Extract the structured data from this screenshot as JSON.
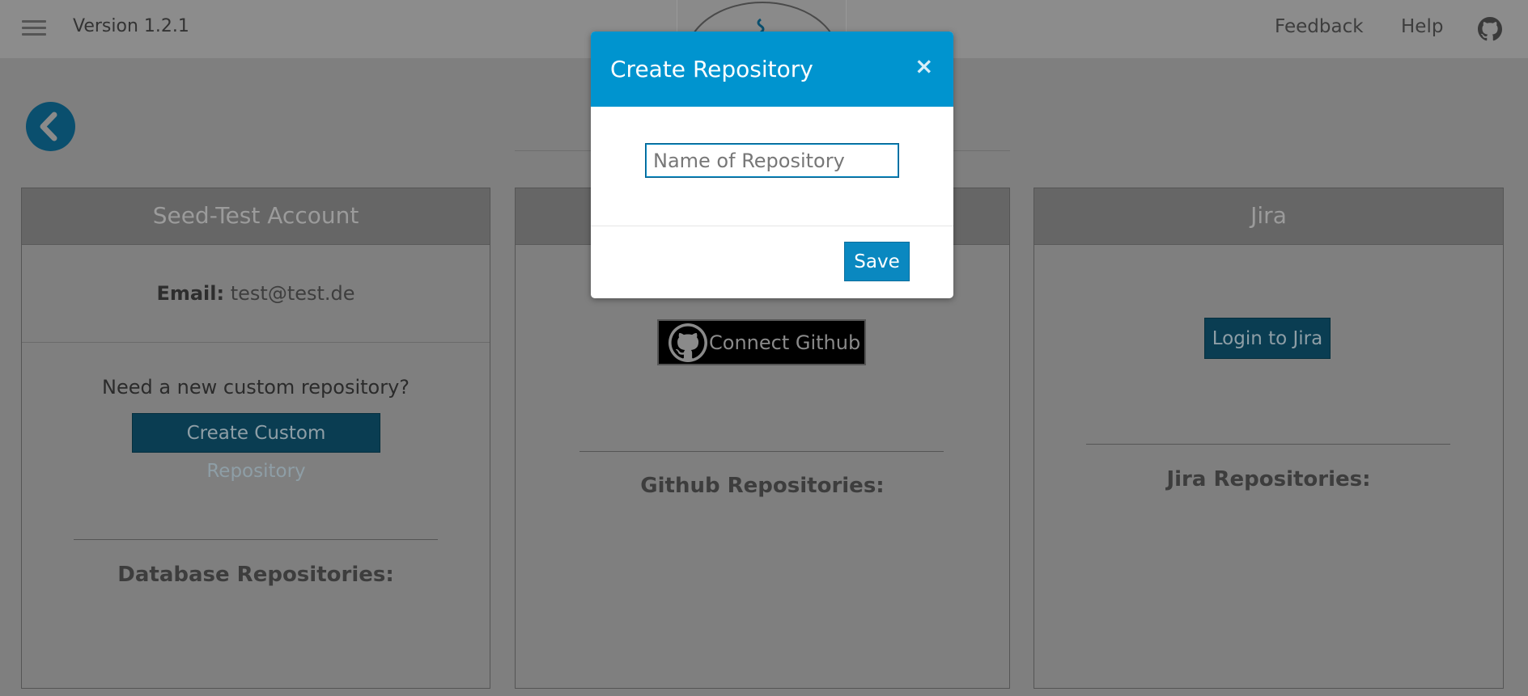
{
  "topbar": {
    "version": "Version 1.2.1",
    "feedback": "Feedback",
    "help": "Help",
    "icons": [
      "hamburger-menu-icon",
      "logo-mark",
      "github-icon"
    ]
  },
  "colors": {
    "brand": "#0094cf",
    "button_dark": "#0a3d52",
    "overlay": "#7f7f7f"
  },
  "cards": {
    "account": {
      "title": "Seed-Test Account",
      "email_label": "Email:",
      "email_value": "test@test.de",
      "need_text": "Need a new custom repository?",
      "create_button": "Create Custom Repository",
      "repos_title": "Database Repositories:"
    },
    "github": {
      "connect_button": "Connect Github",
      "repos_title": "Github Repositories:"
    },
    "jira": {
      "title": "Jira",
      "login_button": "Login to Jira",
      "repos_title": "Jira Repositories:"
    }
  },
  "modal": {
    "title": "Create Repository",
    "close": "×",
    "input_placeholder": "Name of Repository",
    "input_value": "",
    "save_button": "Save"
  }
}
